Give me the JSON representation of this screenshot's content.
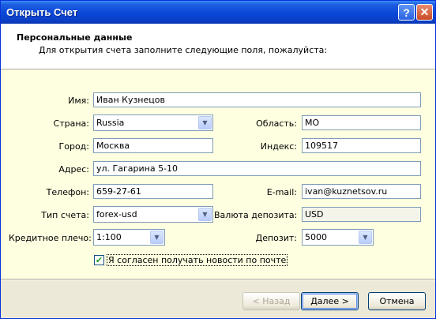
{
  "window": {
    "title": "Открыть Счет"
  },
  "titlebar_buttons": {
    "help": "?",
    "close": "✕"
  },
  "header": {
    "title": "Персональные данные",
    "subtitle": "Для открытия счета заполните следующие поля, пожалуйста:"
  },
  "form": {
    "name": {
      "label": "Имя:",
      "value": "Иван Кузнецов"
    },
    "country": {
      "label": "Страна:",
      "value": "Russia"
    },
    "region": {
      "label": "Область:",
      "value": "MO"
    },
    "city": {
      "label": "Город:",
      "value": "Москва"
    },
    "zip": {
      "label": "Индекс:",
      "value": "109517"
    },
    "address": {
      "label": "Адрес:",
      "value": "ул. Гагарина 5-10"
    },
    "phone": {
      "label": "Телефон:",
      "value": "659-27-61"
    },
    "email": {
      "label": "E-mail:",
      "value": "ivan@kuznetsov.ru"
    },
    "account_type": {
      "label": "Тип счета:",
      "value": "forex-usd"
    },
    "deposit_currency": {
      "label": "Валюта депозита:",
      "value": "USD"
    },
    "leverage": {
      "label": "Кредитное плечо:",
      "value": "1:100"
    },
    "deposit": {
      "label": "Депозит:",
      "value": "5000"
    },
    "newsletter": {
      "label": "Я согласен получать новости по почте",
      "checked": true
    }
  },
  "buttons": {
    "back": "< Назад",
    "next": "Далее >",
    "cancel": "Отмена"
  },
  "icons": {
    "dropdown": "chevron-down-icon",
    "check": "checkmark-icon"
  }
}
